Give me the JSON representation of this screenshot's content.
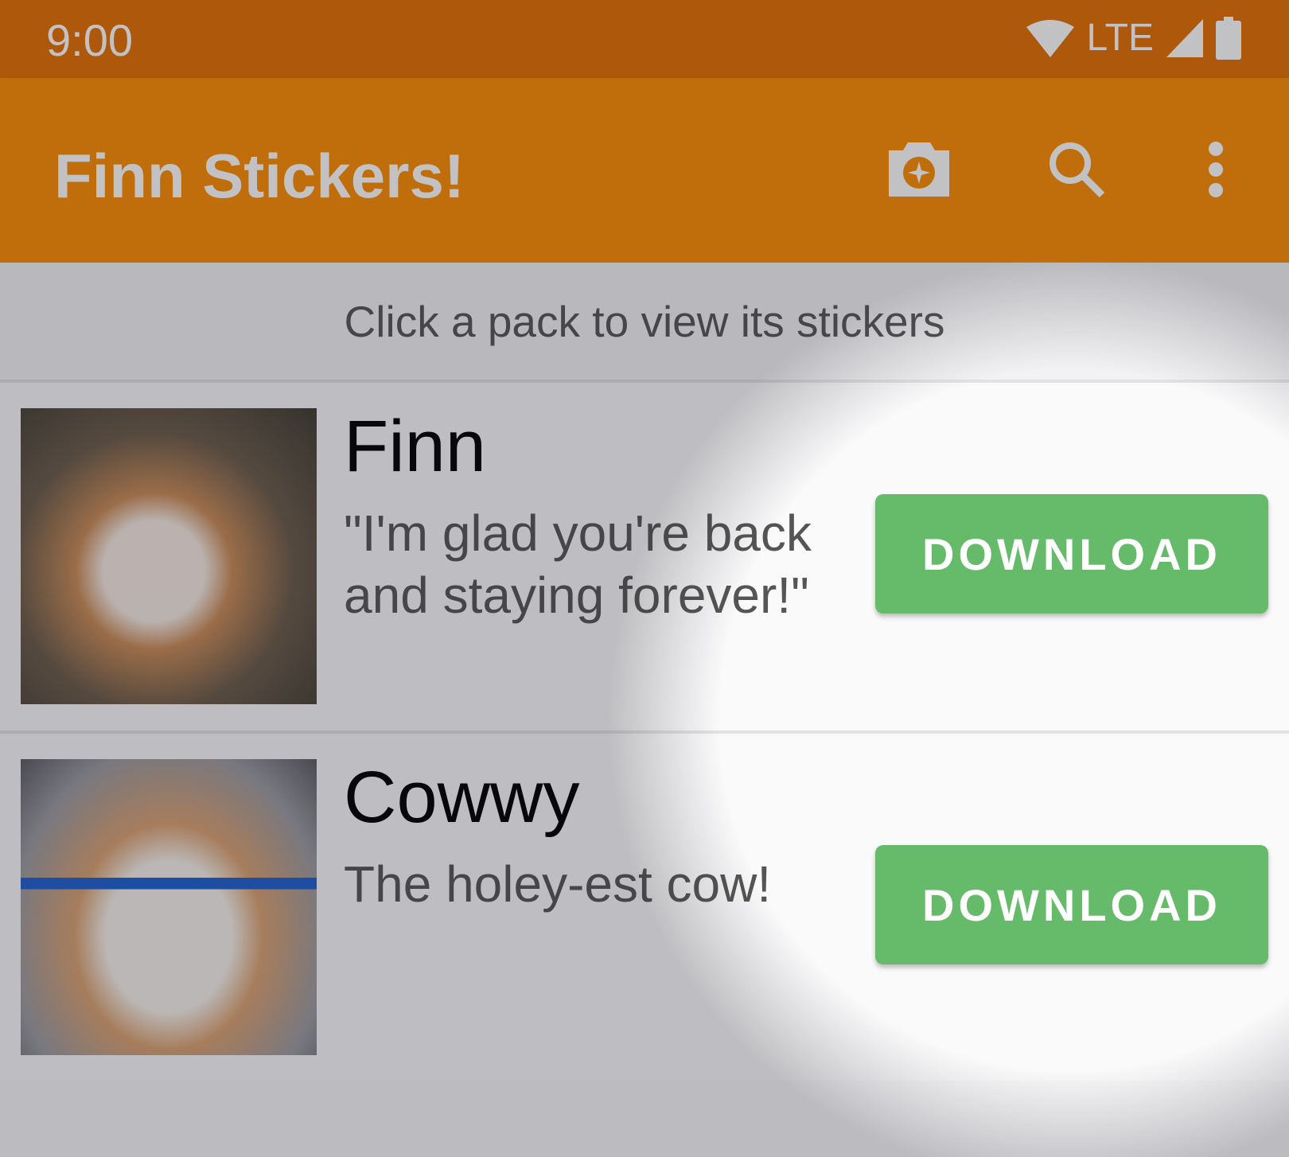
{
  "status_bar": {
    "time": "9:00",
    "network": "LTE",
    "icons": [
      "wifi-icon",
      "signal-icon",
      "battery-icon"
    ]
  },
  "app_bar": {
    "title": "Finn Stickers!",
    "actions": [
      "camera-sparkle-icon",
      "search-icon",
      "more-vert-icon"
    ]
  },
  "hint": "Click a pack to view its stickers",
  "packs": [
    {
      "name": "Finn",
      "description": "\"I'm glad you're back and staying forever!\"",
      "button": "DOWNLOAD"
    },
    {
      "name": "Cowwy",
      "description": "The holey-est cow!",
      "button": "DOWNLOAD"
    }
  ],
  "colors": {
    "primary": "#fc8c00",
    "status": "#e46e00",
    "download": "#66bb6a"
  }
}
